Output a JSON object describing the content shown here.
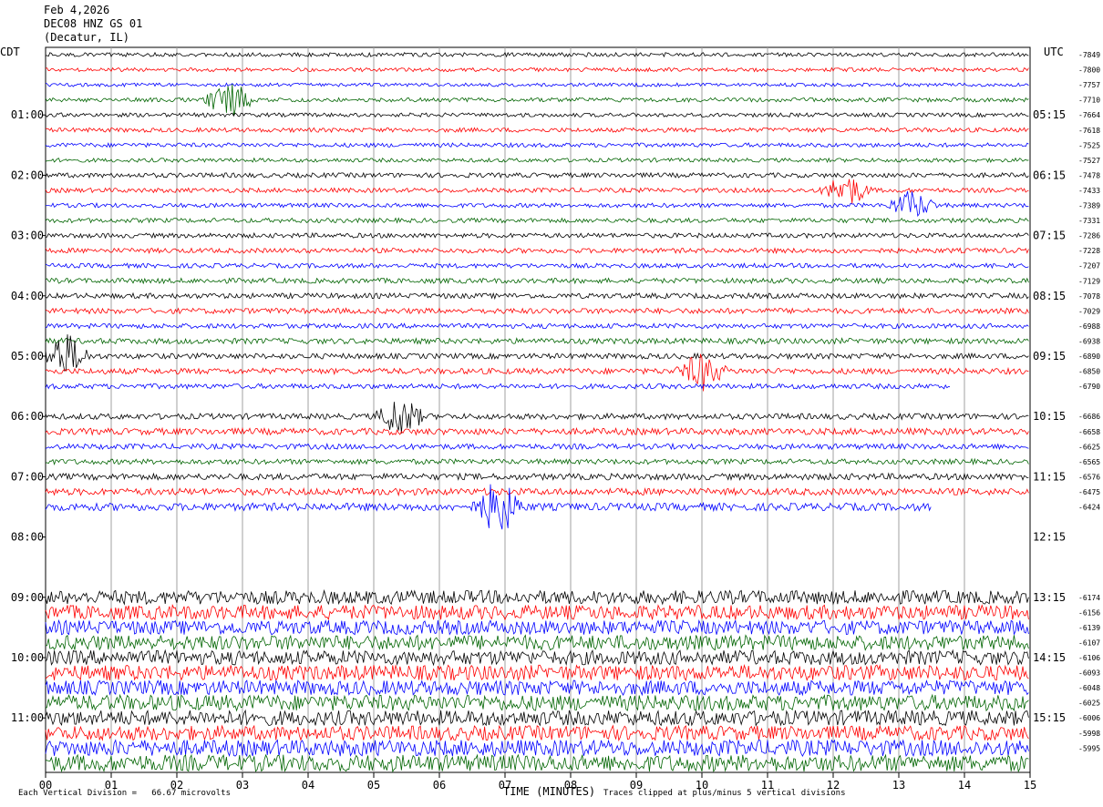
{
  "header": {
    "date": "Feb 4,2026",
    "station": "DEC08 HNZ GS 01",
    "location": "(Decatur, IL)"
  },
  "left_tz": "CDT",
  "right_tz": "UTC",
  "footer": {
    "scale_note": "Each Vertical Division =   66.67 microvolts",
    "time_label": "TIME (MINUTES)",
    "clip_note": "Traces clipped at plus/minus 5 vertical divisions"
  },
  "colors": {
    "black": "#000000",
    "red": "#ff0000",
    "blue": "#0000ff",
    "green": "#006400",
    "grid": "#a0a0a0"
  },
  "chart_data": {
    "type": "line",
    "title": "DEC08 HNZ GS 01",
    "xlabel": "TIME (MINUTES)",
    "ylabel": "",
    "xlim": [
      0,
      15
    ],
    "x_ticks": [
      "00",
      "01",
      "02",
      "03",
      "04",
      "05",
      "06",
      "07",
      "08",
      "09",
      "10",
      "11",
      "12",
      "13",
      "14",
      "15"
    ],
    "left_hour_labels": [
      "01:00",
      "02:00",
      "03:00",
      "04:00",
      "05:00",
      "06:00",
      "07:00",
      "08:00",
      "09:00",
      "10:00",
      "11:00"
    ],
    "right_hour_labels": [
      "05:15",
      "06:15",
      "07:15",
      "08:15",
      "09:15",
      "10:15",
      "11:15",
      "12:15",
      "13:15",
      "14:15",
      "15:15"
    ],
    "trace_color_cycle": [
      "black",
      "red",
      "blue",
      "green"
    ],
    "rows": 48,
    "row_offsets": [
      "-7849",
      "-7800",
      "-7757",
      "-7710",
      "-7664",
      "-7618",
      "-7525",
      "-7527",
      "-7478",
      "-7433",
      "-7389",
      "-7331",
      "-7286",
      "-7228",
      "-7207",
      "-7129",
      "-7078",
      "-7029",
      "-6988",
      "-6938",
      "-6890",
      "-6850",
      "-6790",
      "",
      "-6686",
      "-6658",
      "-6625",
      "-6565",
      "-6576",
      "-6475",
      "-6424",
      "",
      "",
      "",
      "",
      "",
      "-6174",
      "-6156",
      "-6139",
      "-6107",
      "-6106",
      "-6093",
      "-6048",
      "-6025",
      "-6006",
      "-5998",
      "-5995"
    ],
    "row_amplitude": [
      2.2,
      2.1,
      1.9,
      2.3,
      2.2,
      2.4,
      2.3,
      2.2,
      2.6,
      2.5,
      2.4,
      2.5,
      2.6,
      2.7,
      2.5,
      2.8,
      2.9,
      3.0,
      2.7,
      3.1,
      3.0,
      3.2,
      2.8,
      0,
      3.2,
      3.6,
      3.0,
      2.9,
      3.5,
      3.8,
      4.2,
      0,
      0,
      0,
      0,
      0,
      7.5,
      8.0,
      7.8,
      8.2,
      7.9,
      8.4,
      8.1,
      8.6,
      8.3,
      8.0,
      8.9,
      9.2
    ],
    "events": [
      {
        "row": 3,
        "minute": 2.8,
        "amp": 22
      },
      {
        "row": 9,
        "minute": 12.2,
        "amp": 18
      },
      {
        "row": 10,
        "minute": 13.2,
        "amp": 16
      },
      {
        "row": 20,
        "minute": 0.3,
        "amp": 25
      },
      {
        "row": 21,
        "minute": 10.0,
        "amp": 20
      },
      {
        "row": 24,
        "minute": 5.4,
        "amp": 22
      },
      {
        "row": 30,
        "minute": 6.9,
        "amp": 30
      }
    ]
  }
}
